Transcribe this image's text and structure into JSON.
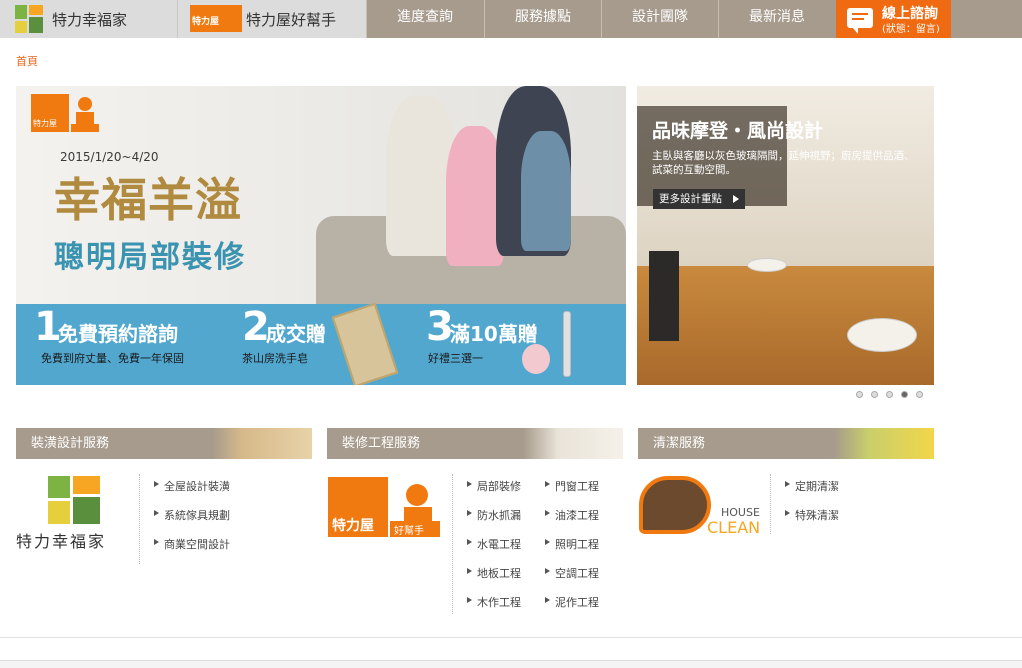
{
  "nav": {
    "brand1": "特力幸福家",
    "brand2": "特力屋好幫手",
    "brand2_badge": "特力屋",
    "items": [
      "進度查詢",
      "服務據點",
      "設計團隊",
      "最新消息"
    ],
    "chat_title": "線上諮詢",
    "chat_status": "(狀態：留言)"
  },
  "breadcrumb": "首頁",
  "banner": {
    "badge": "特力屋",
    "badge_sub": "好幫手",
    "date": "2015/1/20~4/20",
    "headline": "幸福羊溢",
    "subline": "聰明局部裝修",
    "promos": [
      {
        "num": "1",
        "title": "免費預約諮詢",
        "sub": "免費到府丈量、免費一年保固"
      },
      {
        "num": "2",
        "title": "成交贈",
        "sub": "茶山房洗手皂"
      },
      {
        "num": "3",
        "title": "滿10萬贈",
        "sub": "好禮三選一"
      }
    ]
  },
  "side_banner": {
    "title": "品味摩登・風尚設計",
    "desc": "主臥與客廳以灰色玻璃隔間，延伸視野；廚房提供品酒、試菜的互動空間。",
    "more": "更多設計重點"
  },
  "carousel": {
    "count": 5,
    "active": 4
  },
  "sections": [
    {
      "title": "裝潢設計服務",
      "logo_text": "特力幸福家",
      "links": [
        "全屋設計裝潢",
        "系統傢具規劃",
        "商業空間設計"
      ]
    },
    {
      "title": "裝修工程服務",
      "logo_text": "特力屋",
      "logo_sub": "好幫手",
      "links_col1": [
        "局部裝修",
        "防水抓漏",
        "水電工程",
        "地板工程",
        "木作工程"
      ],
      "links_col2": [
        "門窗工程",
        "油漆工程",
        "照明工程",
        "空調工程",
        "泥作工程"
      ]
    },
    {
      "title": "清潔服務",
      "logo_text1": "HOUSE",
      "logo_text2": "CLEAN",
      "links": [
        "定期清潔",
        "特殊清潔"
      ]
    }
  ],
  "colors": {
    "nav_bg": "#a69b8c",
    "accent": "#ef6a10",
    "banner_blue": "#52a7cf",
    "gold": "#b08a3e"
  }
}
